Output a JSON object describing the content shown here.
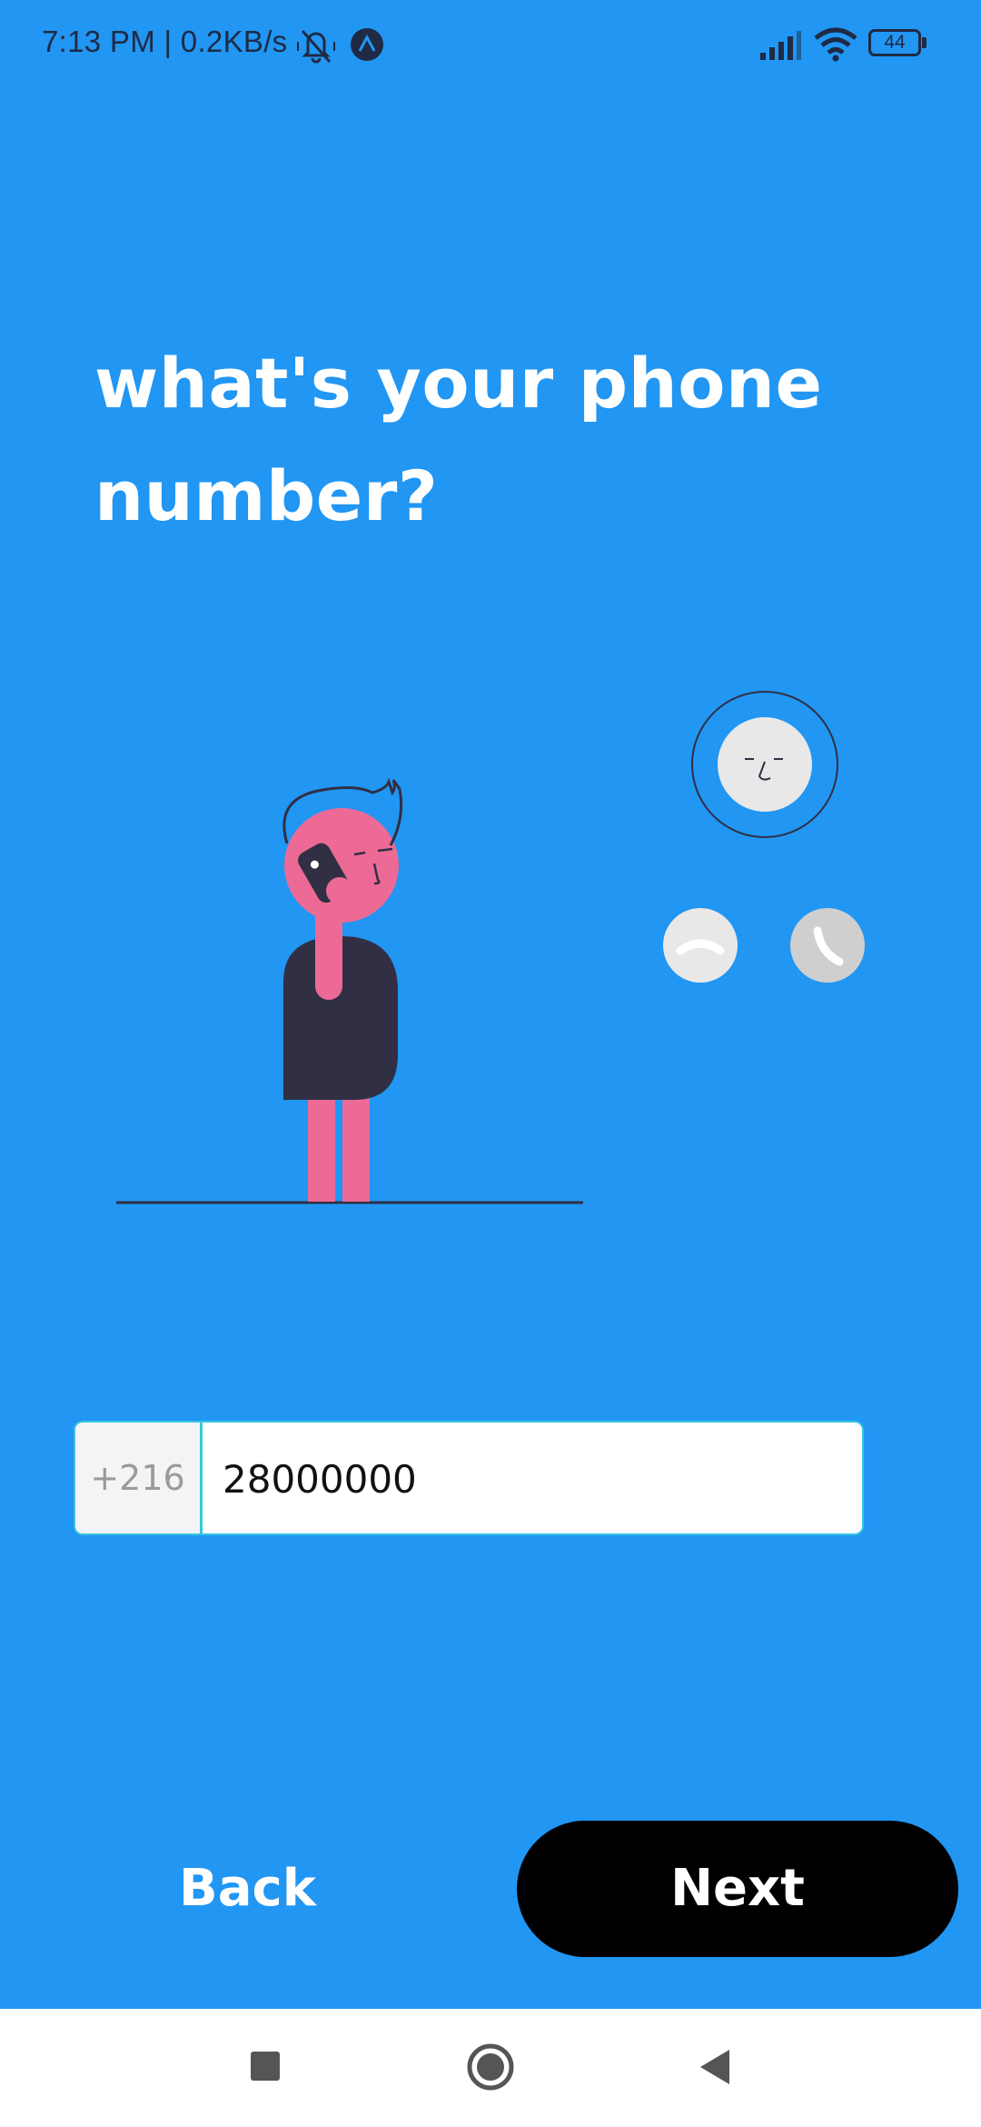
{
  "status_bar": {
    "time_speed": "7:13 PM | 0.2KB/s",
    "battery": "44",
    "icons": [
      "mute-bell-icon",
      "app-notification-icon",
      "signal-icon",
      "wifi-icon",
      "battery-icon"
    ]
  },
  "title": "what's your phone number?",
  "phone": {
    "country_code": "+216",
    "value": "28000000"
  },
  "buttons": {
    "back": "Back",
    "next": "Next"
  },
  "nav": {
    "icons": [
      "recent-apps-icon",
      "home-icon",
      "back-icon"
    ]
  },
  "colors": {
    "background": "#2196F3",
    "accent": "#38c6e0",
    "figure_pink": "#EC6A95",
    "figure_dark": "#302F44"
  }
}
